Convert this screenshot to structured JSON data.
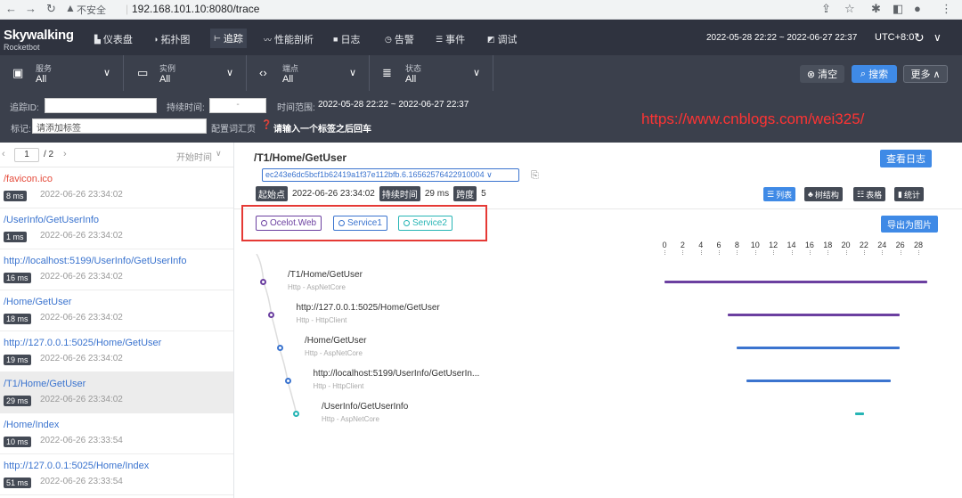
{
  "browser": {
    "insecure_label": "不安全",
    "url": "192.168.101.10:8080/trace"
  },
  "nav": {
    "logo": "Skywalking",
    "logo_sub": "Rocketbot",
    "items": [
      {
        "label": "仪表盘",
        "icon": "dashboard-icon"
      },
      {
        "label": "拓扑图",
        "icon": "topology-icon"
      },
      {
        "label": "追踪",
        "icon": "trace-icon",
        "active": true
      },
      {
        "label": "性能剖析",
        "icon": "profile-icon"
      },
      {
        "label": "日志",
        "icon": "log-icon"
      },
      {
        "label": "告警",
        "icon": "alarm-icon"
      },
      {
        "label": "事件",
        "icon": "event-icon"
      },
      {
        "label": "调试",
        "icon": "debug-icon"
      }
    ],
    "date_range": "2022-05-28 22:22 ~ 2022-06-27 22:37",
    "timezone": "UTC+8:0"
  },
  "filters": {
    "service": {
      "label": "服务",
      "value": "All"
    },
    "instance": {
      "label": "实例",
      "value": "All"
    },
    "endpoint": {
      "label": "端点",
      "value": "All"
    },
    "status": {
      "label": "状态",
      "value": "All"
    },
    "clear_label": "清空",
    "search_label": "搜索",
    "more_label": "更多"
  },
  "search": {
    "trace_id_label": "追踪ID:",
    "duration_label": "持续时间:",
    "duration_sep": "-",
    "time_range_label": "时间范围:",
    "time_range_value": "2022-05-28 22:22 ~ 2022-06-27 22:37",
    "tags_label": "标记:",
    "tags_placeholder": "请添加标签",
    "config_label": "配置词汇页",
    "tags_hint": "请输入一个标签之后回车"
  },
  "watermark": "https://www.cnblogs.com/wei325/",
  "pager": {
    "current": "1",
    "total": "/ 2",
    "sort_label": "开始时间"
  },
  "traces": [
    {
      "endpoint": "/favicon.ico",
      "duration": "8 ms",
      "time": "2022-06-26 23:34:02",
      "error": true
    },
    {
      "endpoint": "/UserInfo/GetUserInfo",
      "duration": "1 ms",
      "time": "2022-06-26 23:34:02",
      "error": false
    },
    {
      "endpoint": "http://localhost:5199/UserInfo/GetUserInfo",
      "duration": "16 ms",
      "time": "2022-06-26 23:34:02",
      "error": false
    },
    {
      "endpoint": "/Home/GetUser",
      "duration": "18 ms",
      "time": "2022-06-26 23:34:02",
      "error": false
    },
    {
      "endpoint": "http://127.0.0.1:5025/Home/GetUser",
      "duration": "19 ms",
      "time": "2022-06-26 23:34:02",
      "error": false
    },
    {
      "endpoint": "/T1/Home/GetUser",
      "duration": "29 ms",
      "time": "2022-06-26 23:34:02",
      "error": false,
      "selected": true
    },
    {
      "endpoint": "/Home/Index",
      "duration": "10 ms",
      "time": "2022-06-26 23:33:54",
      "error": false
    },
    {
      "endpoint": "http://127.0.0.1:5025/Home/Index",
      "duration": "51 ms",
      "time": "2022-06-26 23:33:54",
      "error": false
    }
  ],
  "detail": {
    "title": "/T1/Home/GetUser",
    "trace_id": "ec243e6dc5bcf1b62419a1f37e112bfb.6.16562576422910004",
    "start_label": "起始点",
    "start_value": "2022-06-26 23:34:02",
    "duration_label": "持续时间",
    "duration_value": "29 ms",
    "span_label": "跨度",
    "span_value": "5",
    "view_logs_label": "查看日志",
    "export_label": "导出为图片",
    "views": [
      {
        "label": "列表",
        "icon": "list-icon",
        "active": true
      },
      {
        "label": "树结构",
        "icon": "tree-icon",
        "active": false
      },
      {
        "label": "表格",
        "icon": "table-icon",
        "active": false
      },
      {
        "label": "统计",
        "icon": "stats-icon",
        "active": false
      }
    ],
    "services": [
      {
        "name": "Ocelot.Web",
        "color": "#6b3fa0"
      },
      {
        "name": "Service1",
        "color": "#3b74cf"
      },
      {
        "name": "Service2",
        "color": "#26b5b5"
      }
    ],
    "axis_ticks": [
      "0",
      "2",
      "4",
      "6",
      "8",
      "10",
      "12",
      "14",
      "16",
      "18",
      "20",
      "22",
      "24",
      "26",
      "28"
    ],
    "spans": [
      {
        "endpoint": "/T1/Home/GetUser",
        "type": "Http - AspNetCore",
        "service": 0,
        "start": 0,
        "end": 29
      },
      {
        "endpoint": "http://127.0.0.1:5025/Home/GetUser",
        "type": "Http - HttpClient",
        "service": 0,
        "start": 7,
        "end": 26
      },
      {
        "endpoint": "/Home/GetUser",
        "type": "Http - AspNetCore",
        "service": 1,
        "start": 8,
        "end": 26
      },
      {
        "endpoint": "http://localhost:5199/UserInfo/GetUserIn...",
        "type": "Http - HttpClient",
        "service": 1,
        "start": 9,
        "end": 25
      },
      {
        "endpoint": "/UserInfo/GetUserInfo",
        "type": "Http - AspNetCore",
        "service": 2,
        "start": 21,
        "end": 22
      }
    ]
  }
}
